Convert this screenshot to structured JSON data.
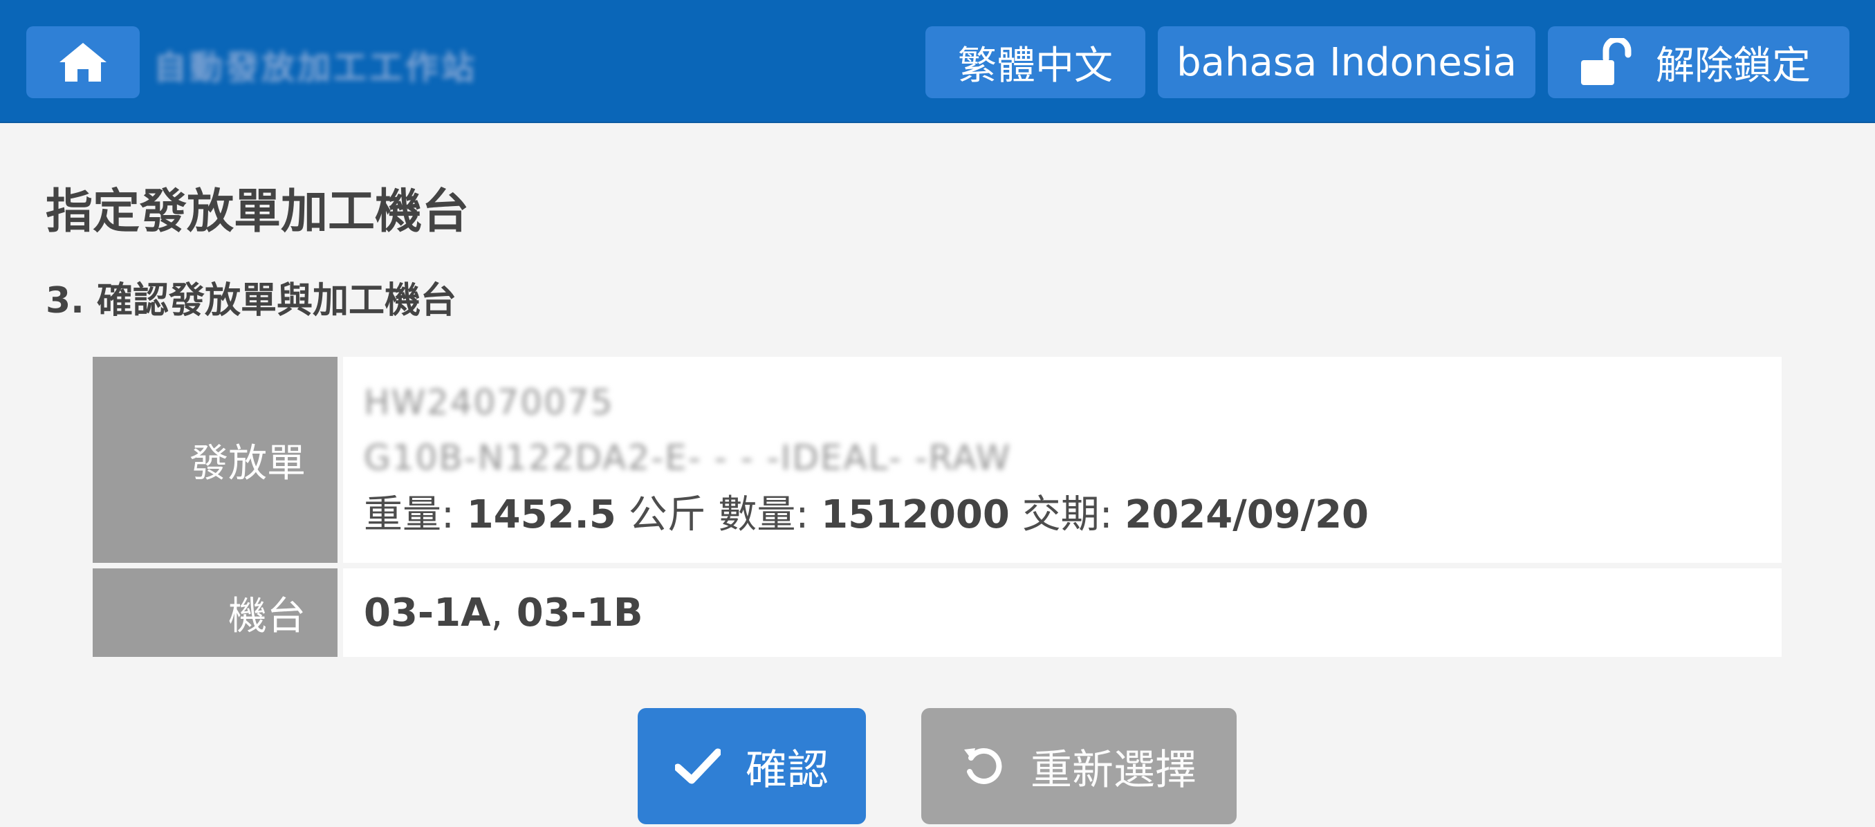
{
  "header": {
    "app_title_blurred": "自動發放加工工作站",
    "lang_zh_label": "繁體中文",
    "lang_id_label": "bahasa Indonesia",
    "unlock_label": "解除鎖定"
  },
  "page": {
    "title": "指定發放單加工機台",
    "step_title": "3. 確認發放單與加工機台"
  },
  "order": {
    "label": "發放單",
    "order_no_blurred": "HW24070075",
    "spec_blurred": "G10B-N122DA2-E- - - -IDEAL- -RAW",
    "weight_label": "重量:",
    "weight_value": "1452.5",
    "weight_unit": "公斤",
    "qty_label": "數量:",
    "qty_value": "1512000",
    "due_label": "交期:",
    "due_value": "2024/09/20"
  },
  "machine": {
    "label": "機台",
    "value_1": "03-1A",
    "separator": ",",
    "value_2": "03-1B"
  },
  "actions": {
    "confirm_label": "確認",
    "reselect_label": "重新選擇"
  },
  "colors": {
    "header_bg": "#0a66b8",
    "button_blue": "#2f80d6",
    "label_gray": "#9c9c9c",
    "reselect_gray": "#a3a3a3"
  }
}
